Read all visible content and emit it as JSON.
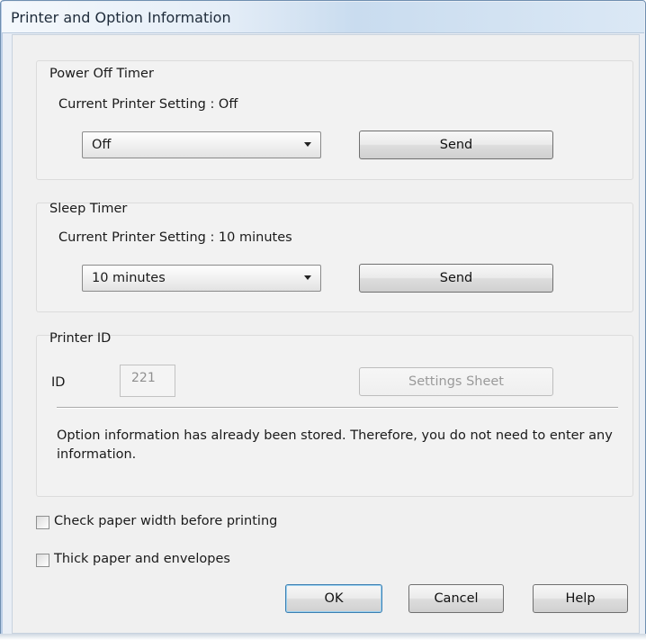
{
  "window": {
    "title": "Printer and Option Information"
  },
  "power_off_timer": {
    "label": "Power Off Timer",
    "current_setting": "Current Printer Setting : Off",
    "selected": "Off",
    "send_label": "Send"
  },
  "sleep_timer": {
    "label": "Sleep Timer",
    "current_setting": "Current Printer Setting : 10 minutes",
    "selected": "10 minutes",
    "send_label": "Send"
  },
  "printer_id": {
    "label": "Printer ID",
    "id_label": "ID",
    "id_value": "221",
    "settings_sheet_label": "Settings Sheet",
    "info_text": "Option information has already been stored. Therefore, you do not need to enter any information."
  },
  "options": {
    "check_paper_width": {
      "label": "Check paper width before printing",
      "checked": false
    },
    "thick_paper": {
      "label": "Thick paper and envelopes",
      "checked": false
    }
  },
  "buttons": {
    "ok": "OK",
    "cancel": "Cancel",
    "help": "Help"
  },
  "colors": {
    "title_gradient_end": "#c9dcef",
    "default_button_border": "#3c7fb1",
    "disabled_text": "#9a9a9a"
  }
}
